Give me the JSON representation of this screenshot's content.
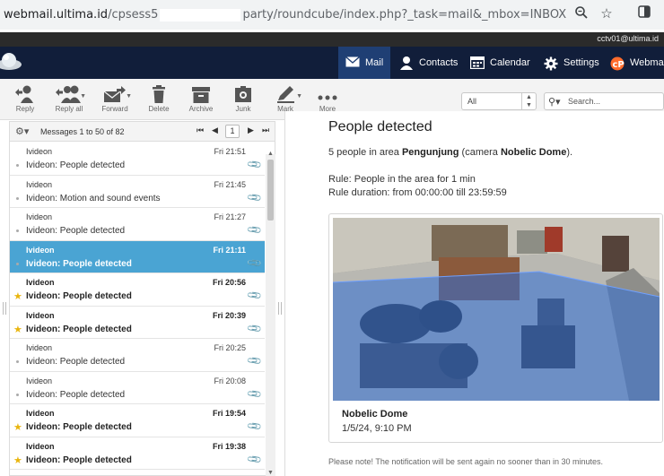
{
  "browser": {
    "url_host": "webmail.ultima.id",
    "url_path_start": "/cpsess5",
    "url_path_end": "party/roundcube/index.php?_task=mail&_mbox=INBOX",
    "zoom_icon": "magnifier-icon",
    "bookmark_icon": "star-outline-icon",
    "sidebar_icon": "sidebar-icon"
  },
  "account": {
    "user": "cctv01@ultima.id"
  },
  "nav": {
    "mail": "Mail",
    "contacts": "Contacts",
    "calendar": "Calendar",
    "settings": "Settings",
    "webmail": "Webma"
  },
  "toolbar": {
    "reply": "Reply",
    "reply_all": "Reply all",
    "forward": "Forward",
    "delete": "Delete",
    "archive": "Archive",
    "junk": "Junk",
    "mark": "Mark",
    "more": "More",
    "filter_value": "All",
    "search_placeholder": "Search..."
  },
  "list": {
    "count_label": "Messages 1 to 50 of 82",
    "page": "1",
    "messages": [
      {
        "from": "Ivideon",
        "date": "Fri 21:51",
        "subject": "Ivideon: People detected",
        "unread": false,
        "flagged": false,
        "selected": false
      },
      {
        "from": "Ivideon",
        "date": "Fri 21:45",
        "subject": "Ivideon: Motion and sound events",
        "unread": false,
        "flagged": false,
        "selected": false
      },
      {
        "from": "Ivideon",
        "date": "Fri 21:27",
        "subject": "Ivideon: People detected",
        "unread": false,
        "flagged": false,
        "selected": false
      },
      {
        "from": "Ivideon",
        "date": "Fri 21:11",
        "subject": "Ivideon: People detected",
        "unread": false,
        "flagged": false,
        "selected": true
      },
      {
        "from": "Ivideon",
        "date": "Fri 20:56",
        "subject": "Ivideon: People detected",
        "unread": true,
        "flagged": true,
        "selected": false
      },
      {
        "from": "Ivideon",
        "date": "Fri 20:39",
        "subject": "Ivideon: People detected",
        "unread": true,
        "flagged": true,
        "selected": false
      },
      {
        "from": "Ivideon",
        "date": "Fri 20:25",
        "subject": "Ivideon: People detected",
        "unread": false,
        "flagged": false,
        "selected": false
      },
      {
        "from": "Ivideon",
        "date": "Fri 20:08",
        "subject": "Ivideon: People detected",
        "unread": false,
        "flagged": false,
        "selected": false
      },
      {
        "from": "Ivideon",
        "date": "Fri 19:54",
        "subject": "Ivideon: People detected",
        "unread": true,
        "flagged": true,
        "selected": false
      },
      {
        "from": "Ivideon",
        "date": "Fri 19:38",
        "subject": "Ivideon: People detected",
        "unread": true,
        "flagged": true,
        "selected": false
      }
    ]
  },
  "preview": {
    "title": "People detected",
    "line1_prefix": "5 people in area ",
    "line1_area": "Pengunjung",
    "line1_mid": " (camera ",
    "line1_camera": "Nobelic Dome",
    "line1_suffix": ").",
    "rule": "Rule: People in the area for 1 min",
    "rule_duration": "Rule duration: from 00:00:00 till 23:59:59",
    "camera_name": "Nobelic Dome",
    "snapshot_time": "1/5/24, 9:10 PM",
    "note": "Please note! The notification will be sent again no sooner than in 30 minutes."
  },
  "colors": {
    "nav_bg": "#111e3a",
    "nav_active": "#1f3f74",
    "selected_row": "#4aa4d3",
    "flag_star": "#e9b50e",
    "detection_overlay": "#2f6ed6"
  }
}
